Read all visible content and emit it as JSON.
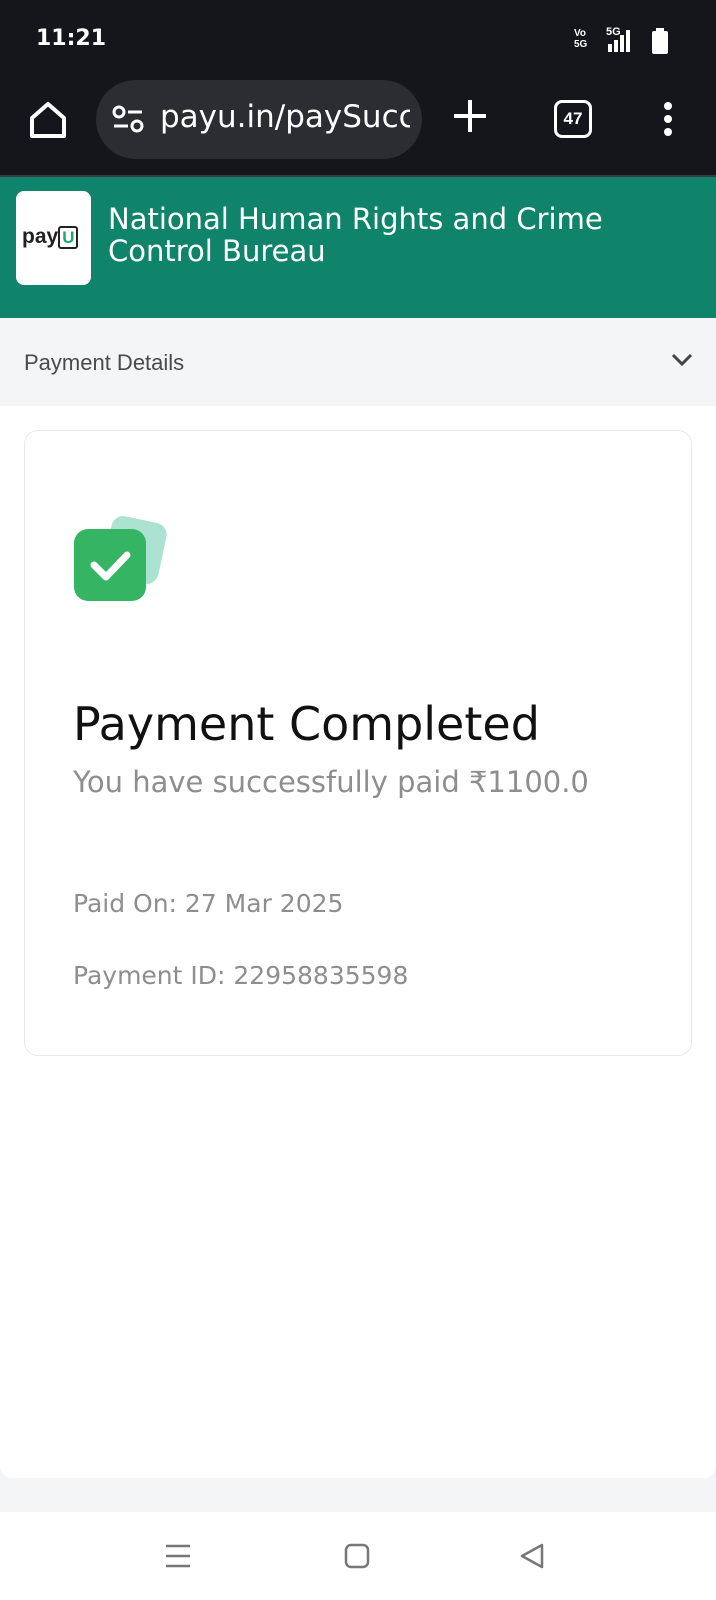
{
  "status_bar": {
    "time": "11:21",
    "network_label": "Vo 5G",
    "signal_label": "5G"
  },
  "browser": {
    "url": "payu.in/paySuccess",
    "tab_count": "47",
    "icons": [
      "home-icon",
      "site-settings-icon",
      "plus-icon",
      "tab-switcher-icon",
      "more-vert-icon"
    ]
  },
  "merchant": {
    "logo_text": "payU",
    "name": "National Human Rights and Crime Control Bureau",
    "header_color": "#10846b"
  },
  "details_bar": {
    "label": "Payment Details",
    "icon": "chevron-down-icon"
  },
  "payment": {
    "title": "Payment Completed",
    "message": "You have successfully paid ₹1100.0",
    "paid_on": "Paid On: 27 Mar 2025",
    "payment_id": "Payment ID: 22958835598",
    "status_icon": "check-icon",
    "status_color": "#35b564"
  },
  "nav_bar": {
    "icons": [
      "recent-apps-icon",
      "home-square-icon",
      "back-triangle-icon"
    ]
  }
}
